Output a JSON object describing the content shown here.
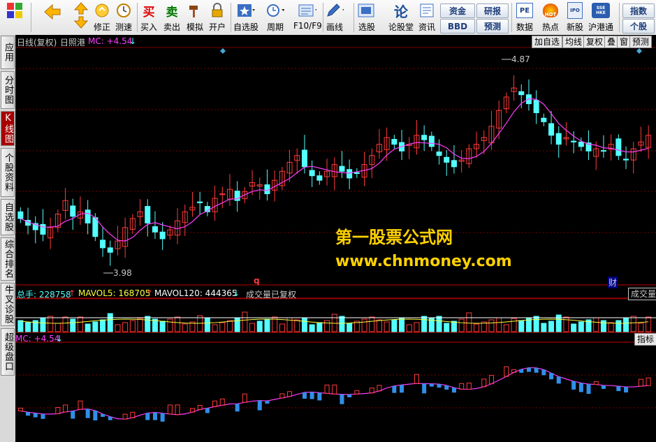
{
  "toolbar": {
    "items": [
      {
        "label": "",
        "icon": "app-logo-icon"
      },
      {
        "label": "",
        "icon": "back-arrow-icon"
      },
      {
        "label": "",
        "icon": "up-down-arrow-icon"
      },
      {
        "label": "修正",
        "icon": "refresh-icon"
      },
      {
        "label": "测速",
        "icon": "clock-icon"
      },
      {
        "label": "买入",
        "icon": "buy-icon"
      },
      {
        "label": "卖出",
        "icon": "sell-icon"
      },
      {
        "label": "模拟",
        "icon": "hammer-icon"
      },
      {
        "label": "开户",
        "icon": "lock-icon"
      },
      {
        "label": "自选股",
        "icon": "star-icon"
      },
      {
        "label": "周期",
        "icon": "period-clock-icon"
      },
      {
        "label": "F10/F9",
        "icon": "f10-icon"
      },
      {
        "label": "画线",
        "icon": "pencil-icon"
      },
      {
        "label": "选股",
        "icon": "select-stock-icon"
      },
      {
        "label": "论股堂",
        "icon": "forum-icon"
      },
      {
        "label": "资讯",
        "icon": "news-icon"
      },
      {
        "label": "数据",
        "icon": "pe-icon"
      },
      {
        "label": "热点",
        "icon": "hot-icon"
      },
      {
        "label": "新股",
        "icon": "ipo-icon"
      },
      {
        "label": "沪港通",
        "icon": "sse-hkex-icon"
      }
    ],
    "glyphs": {
      "buy": "买",
      "sell": "卖",
      "forum": "论",
      "pe": "PE",
      "hot": "HOT",
      "ipo": "IPO",
      "hk": "SSE HKE"
    },
    "pills": {
      "fund": "资金",
      "bbd": "BBD",
      "research": "研报",
      "forecast": "预测",
      "index": "指数",
      "stock": "个股"
    }
  },
  "side_tabs": [
    {
      "label": "应用",
      "active": false
    },
    {
      "label": "分时图",
      "active": false
    },
    {
      "label": "K线图",
      "active": true
    },
    {
      "label": "个股资料",
      "active": false
    },
    {
      "label": "自选股",
      "active": false
    },
    {
      "label": "综合排名",
      "active": false
    },
    {
      "label": "牛叉诊股",
      "active": false
    },
    {
      "label": "超级盘口",
      "active": false
    }
  ],
  "main_header": {
    "period": "日线(复权)",
    "stock": "日照港",
    "mc_label": "MC: +4.54",
    "mc_arrow": "↓",
    "buttons": [
      "加自选",
      "均线",
      "复权",
      "叠",
      "窗",
      "预测"
    ],
    "high_label": "4.87",
    "low_label": "3.98",
    "marker_q": "q",
    "marker_cai": "财"
  },
  "volume_header": {
    "total": "总手: 228758",
    "total_arrow": "↑",
    "mavol5": "MAVOL5: 168705",
    "mavol5_arrow": "↑",
    "mavol120": "MAVOL120: 444365",
    "mavol120_arrow": "↓",
    "note": "成交量已复权",
    "button": "成交量"
  },
  "indicator_header": {
    "label": "MC: +4.54",
    "arrow": "↓",
    "button": "指标d"
  },
  "watermark": {
    "line1": "第一股票公式网",
    "line2": "www.chnmoney.com"
  },
  "colors": {
    "up": "#ff3b3b",
    "down": "#54ffff",
    "ma": "#ff3cff",
    "grid": "#7a0000",
    "blue": "#2f8fe8",
    "mavol": "#ffffff",
    "watermark": "#ffd200"
  },
  "chart_data": {
    "type": "candlestick",
    "series": [
      {
        "name": "price_close",
        "values": [
          4.19,
          4.16,
          4.14,
          4.12,
          4.15,
          4.21,
          4.27,
          4.2,
          4.22,
          4.17,
          4.11,
          4.06,
          4.04,
          4.09,
          4.15,
          4.19,
          4.22,
          4.17,
          4.13,
          4.1,
          4.14,
          4.18,
          4.22,
          4.24,
          4.26,
          4.22,
          4.28,
          4.3,
          4.32,
          4.27,
          4.31,
          4.35,
          4.34,
          4.3,
          4.36,
          4.4,
          4.44,
          4.47,
          4.42,
          4.38,
          4.36,
          4.4,
          4.43,
          4.4,
          4.37,
          4.39,
          4.43,
          4.47,
          4.52,
          4.55,
          4.52,
          4.49,
          4.52,
          4.56,
          4.54,
          4.51,
          4.47,
          4.44,
          4.42,
          4.45,
          4.5,
          4.52,
          4.55,
          4.6,
          4.67,
          4.73,
          4.77,
          4.74,
          4.7,
          4.66,
          4.62,
          4.56,
          4.52,
          4.55,
          4.53,
          4.51,
          4.49,
          4.5,
          4.49,
          4.52,
          4.47,
          4.45,
          4.5,
          4.53,
          4.56
        ]
      }
    ],
    "labels": [
      "4.87",
      "3.98"
    ]
  }
}
